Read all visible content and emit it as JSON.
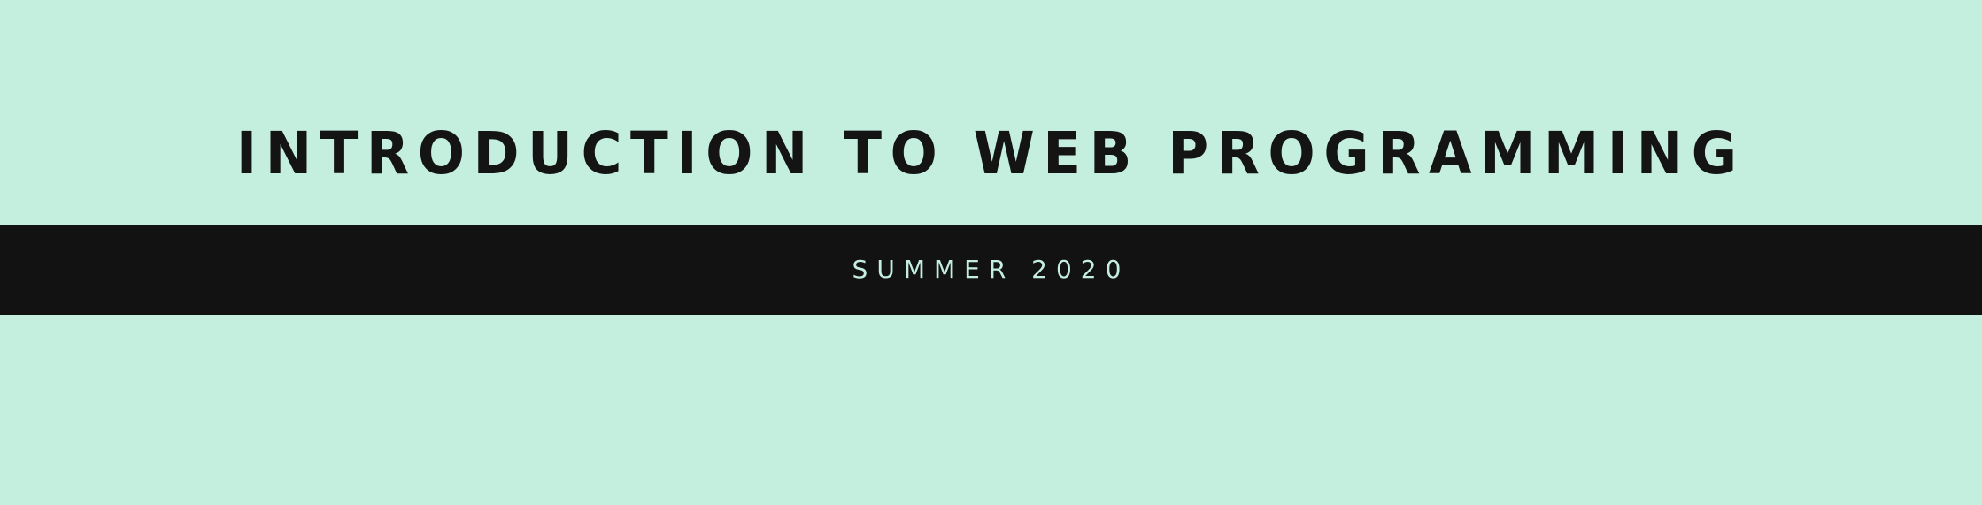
{
  "header": {
    "title": "INTRODUCTION TO WEB PROGRAMMING",
    "subtitle": "SUMMER 2020"
  },
  "colors": {
    "background": "#c4efdf",
    "band": "#121212",
    "title_text": "#141414",
    "subtitle_text": "#c4efdf"
  }
}
